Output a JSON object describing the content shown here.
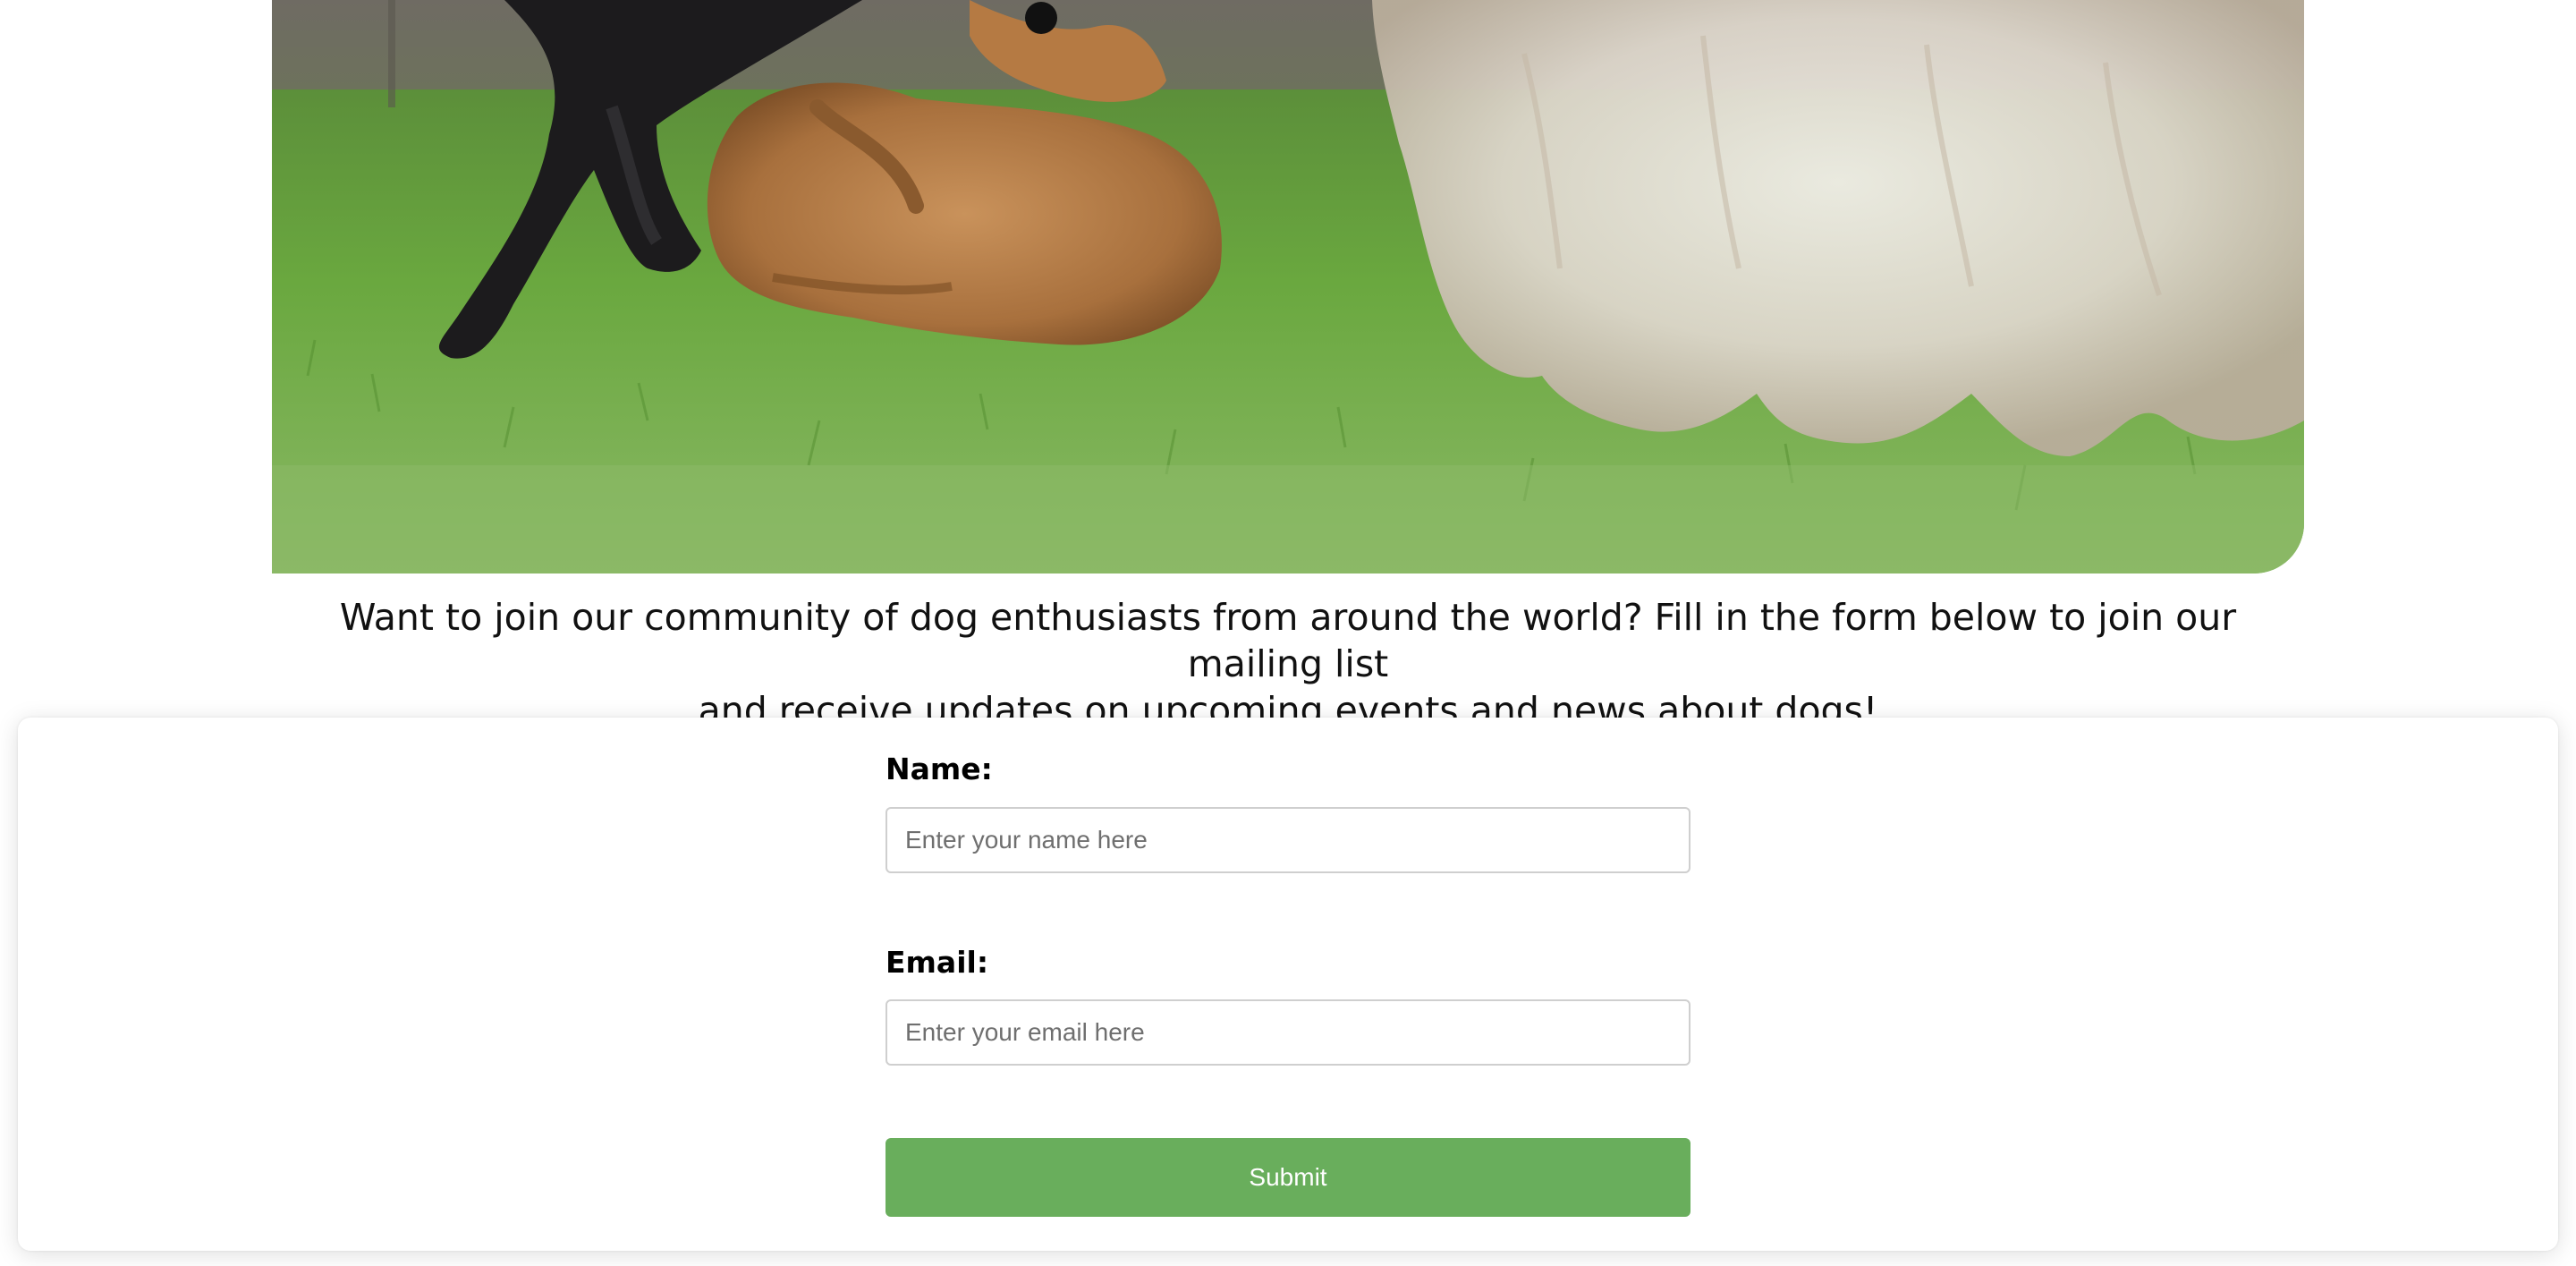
{
  "hero": {
    "image_alt": "Dogs playing on the grass"
  },
  "intro": {
    "line1": "Want to join our community of dog enthusiasts from around the world? Fill in the form below to join our mailing list",
    "line2": "and receive updates on upcoming events and news about dogs!"
  },
  "form": {
    "name_label": "Name:",
    "name_placeholder": "Enter your name here",
    "name_value": "",
    "email_label": "Email:",
    "email_placeholder": "Enter your email here",
    "email_value": "",
    "submit_label": "Submit"
  },
  "colors": {
    "submit_background": "#69ae5c",
    "submit_text": "#ffffff",
    "page_background": "#ffffff"
  }
}
